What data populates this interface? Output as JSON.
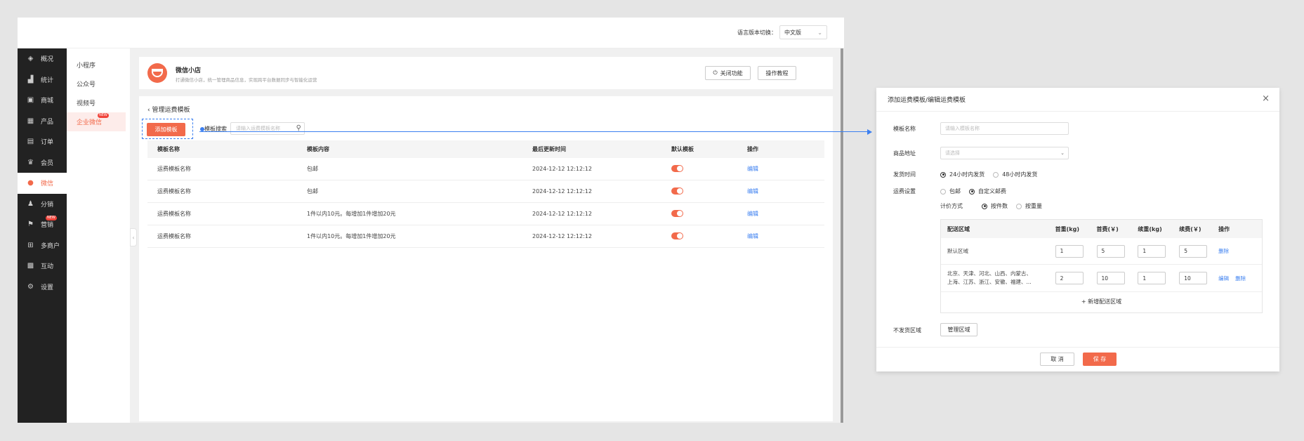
{
  "topbar": {
    "lang_label": "语言版本切换：",
    "lang_value": "中文版"
  },
  "sidebar": {
    "items": [
      {
        "label": "概况",
        "icon": "layers-icon"
      },
      {
        "label": "统计",
        "icon": "chart-icon"
      },
      {
        "label": "商城",
        "icon": "store-icon"
      },
      {
        "label": "产品",
        "icon": "grid-icon"
      },
      {
        "label": "订单",
        "icon": "order-icon"
      },
      {
        "label": "会员",
        "icon": "crown-icon"
      },
      {
        "label": "微信",
        "icon": "wechat-icon"
      },
      {
        "label": "分销",
        "icon": "users-icon"
      },
      {
        "label": "营销",
        "icon": "flag-icon"
      },
      {
        "label": "多商户",
        "icon": "shop-icon"
      },
      {
        "label": "互动",
        "icon": "apps-icon"
      },
      {
        "label": "设置",
        "icon": "gear-icon"
      }
    ],
    "badge": "NEW"
  },
  "subnav": {
    "items": [
      "小程序",
      "公众号",
      "视频号",
      "企业微信"
    ],
    "badge": "NEW"
  },
  "shop": {
    "title": "微信小店",
    "desc": "打通微信小店，统一管理商品信息，实现跨平台数据同步与智能化运营",
    "close_btn": "关闭功能",
    "tutorial_btn": "操作教程"
  },
  "content": {
    "back_label": "管理运费模板",
    "add_btn": "添加模板",
    "search_label": "模板搜索",
    "search_placeholder": "请输入运费模板名称",
    "headers": [
      "模板名称",
      "模板内容",
      "最后更新时间",
      "默认模板",
      "操作"
    ],
    "rows": [
      {
        "name": "运费模板名称",
        "content": "包邮",
        "time": "2024-12-12 12:12:12",
        "action": "编辑"
      },
      {
        "name": "运费模板名称",
        "content": "包邮",
        "time": "2024-12-12 12:12:12",
        "action": "编辑"
      },
      {
        "name": "运费模板名称",
        "content": "1件以内10元。每增加1件增加20元",
        "time": "2024-12-12 12:12:12",
        "action": "编辑"
      },
      {
        "name": "运费模板名称",
        "content": "1件以内10元。每增加1件增加20元",
        "time": "2024-12-12 12:12:12",
        "action": "编辑"
      }
    ]
  },
  "dialog": {
    "title": "添加运费模板/编辑运费模板",
    "name_label": "模板名称",
    "name_placeholder": "请输入模板名称",
    "addr_label": "商品地址",
    "addr_placeholder": "请选择",
    "ship_label": "发货时间",
    "ship_opt1": "24小时内发货",
    "ship_opt2": "48小时内发货",
    "fee_label": "运费设置",
    "fee_opt1": "包邮",
    "fee_opt2": "自定义邮费",
    "calc_label": "计价方式",
    "calc_opt1": "按件数",
    "calc_opt2": "按重量",
    "table_headers": [
      "配送区域",
      "首重(kg)",
      "首费(￥)",
      "续重(kg)",
      "续费(￥)",
      "操作"
    ],
    "table_rows": [
      {
        "area1": "默认区域",
        "area2": "",
        "v1": "1",
        "v2": "5",
        "v3": "1",
        "v4": "5",
        "edit": "",
        "del": "删除"
      },
      {
        "area1": "北京、天津、河北、山西、内蒙古、",
        "area2": "上海、江苏、浙江、安徽、福建、...",
        "v1": "2",
        "v2": "10",
        "v3": "1",
        "v4": "10",
        "edit": "编辑",
        "del": "删除"
      }
    ],
    "add_area": "+ 新增配送区域",
    "noship_label": "不发货区域",
    "manage_btn": "管理区域",
    "cancel_btn": "取 消",
    "save_btn": "保 存"
  },
  "colors": {
    "accent": "#f26a4b",
    "link": "#3b7ff0",
    "sidebar": "#222222"
  }
}
